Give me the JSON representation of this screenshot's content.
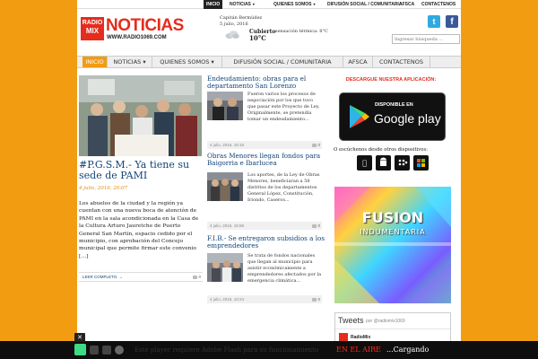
{
  "top_nav": {
    "items": [
      {
        "label": "INICIO",
        "active": true
      },
      {
        "label": "NOTICIAS",
        "caret": true
      },
      {
        "label": "QUIENES SOMOS",
        "caret": true
      },
      {
        "label": "DIFUSIÓN SOCIAL / COMUNITARIA"
      },
      {
        "label": "AFSCA"
      },
      {
        "label": "CONTACTENOS"
      }
    ]
  },
  "header": {
    "logo_box_line1": "RADIO",
    "logo_box_line2": "MIX",
    "logo_main": "NOTICIAS",
    "logo_url": "WWW.RADIO1069.COM",
    "search_placeholder": "Ingresar búsqueda ...",
    "twitter_glyph": "t",
    "facebook_glyph": "f"
  },
  "weather": {
    "city": "Capitán Bermúdez",
    "date": "5 julio, 2016",
    "condition": "Cubierto",
    "sensation": "sensación térmica: 8°C",
    "temperature": "10°C",
    "icon": "cloud-icon"
  },
  "main_nav": {
    "items": [
      {
        "label": "INICIO",
        "active": true
      },
      {
        "label": "NOTICIAS ▾"
      },
      {
        "label": "QUIENES SOMOS ▾"
      },
      {
        "label": "DIFUSIÓN SOCIAL / COMUNITARIA"
      },
      {
        "label": "AFSCA"
      },
      {
        "label": "CONTACTENOS"
      }
    ]
  },
  "featured": {
    "title": "#P.G.S.M.- Ya tiene su sede de PAMI",
    "date": "4 julio, 2016, 20:07",
    "text": "Los abuelos de la ciudad y la región ya cuentan con una nueva boca de atención de PAMI en la sala acondicionada en la Casa de la Cultura Arturo Jauretche de Puerto General San Martín, espacio cedido por el municipio, con aprobación del Concejo municipal que permite firmar este convenio […]",
    "more": "LEER COMPLETO. →",
    "comments": "0"
  },
  "articles": [
    {
      "title": "Endeudamiento: obras para el departamento San Lorenzo",
      "text": "Fueron varios los procesos de negociación por los que tuvo que pasar este Proyecto de Ley. Originalmente, se pretendía tomar un endeudamiento...",
      "date": "4 julio, 2016, 15:18",
      "comments": "0"
    },
    {
      "title": "Obras Menores llegan fondos para Baigorria e Ibarlucea",
      "text": "Los aportes, de la Ley de Obras Menores, beneficiaran a 58 distritos de los departamentos General López, Constitución, Iriondo, Caseros...",
      "date": "4 julio, 2016, 15:59",
      "comments": "0"
    },
    {
      "title": "F.I.B.- Se entregaron subsidios a los emprendedores",
      "text": "Se trata de fondos nacionales que llegan al municipio para asistir económicamente a emprendedores afectados por la emergencia climática...",
      "date": "4 julio, 2016, 10:24",
      "comments": "0"
    }
  ],
  "sidebar": {
    "app_title": "DESCARGUE NUESTRA APLICACIÓN:",
    "gplay_small": "DISPONIBLE EN",
    "gplay_big": "Google play",
    "listen_text": "O escúchenos desde otros dispositivos:",
    "devices": [
      "apple-icon",
      "android-icon",
      "blackberry-icon",
      "windows-icon"
    ],
    "banner_line1": "FUSION",
    "banner_line2": "INDUMENTARIA",
    "tweets_title": "Tweets",
    "tweets_handle": "por @radiomix1069",
    "tweet_user": "RadioMix"
  },
  "player": {
    "message": "Este player requiere Adobe Flash para su funcionamiento",
    "on_air": "EN EL AIRE",
    "loading": "...Cargando"
  },
  "colors": {
    "accent": "#f29c12",
    "brand_red": "#e52c1d",
    "link_blue": "#114477",
    "twitter": "#2faae1",
    "facebook": "#3b5998"
  }
}
